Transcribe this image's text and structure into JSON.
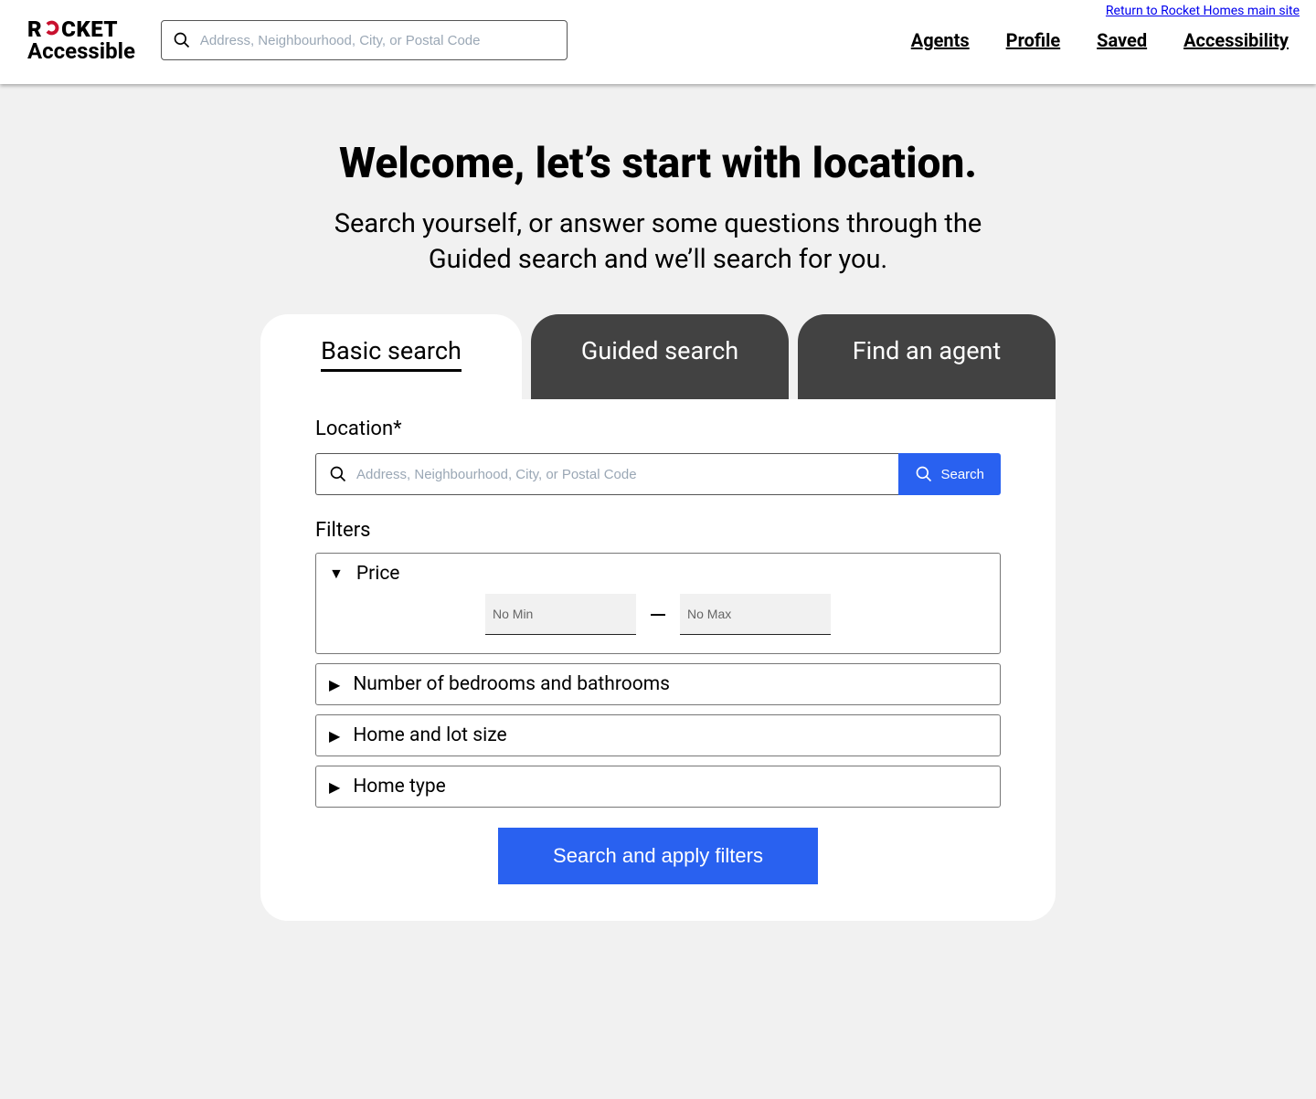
{
  "header": {
    "return_link": "Return to Rocket Homes main site",
    "logo_prefix": "R",
    "logo_suffix": "CKET",
    "logo_sub": "Accessible",
    "search_placeholder": "Address, Neighbourhood, City, or Postal Code",
    "nav": {
      "agents": "Agents",
      "profile": "Profile",
      "saved": "Saved",
      "accessibility": "Accessibility"
    }
  },
  "hero": {
    "title": "Welcome, let’s start with location.",
    "subtitle": "Search yourself, or answer some questions through the Guided search and we’ll search for you."
  },
  "tabs": {
    "basic": "Basic search",
    "guided": "Guided search",
    "agent": "Find an agent"
  },
  "form": {
    "location_label": "Location*",
    "location_placeholder": "Address, Neighbourhood, City, or Postal Code",
    "search_btn": "Search",
    "filters_label": "Filters",
    "filters": {
      "price": "Price",
      "price_min_placeholder": "No Min",
      "price_max_placeholder": "No Max",
      "bedbath": "Number of bedrooms and bathrooms",
      "homelot": "Home and lot size",
      "hometype": "Home type"
    },
    "apply_btn": "Search and apply filters"
  },
  "colors": {
    "accent": "#2961f0",
    "tab_inactive": "#424242",
    "logo_red": "#c8102e"
  }
}
